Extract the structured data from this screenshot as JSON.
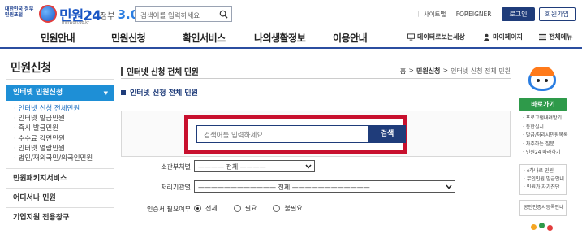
{
  "header": {
    "gov_logo_text": "대한민국 정부민원포털",
    "site_name": "민원24",
    "site_url": "minwon.go.kr",
    "gov30_prefix": "정부",
    "gov30_number": "3.0",
    "search_placeholder": "검색어를 입력하세요",
    "util_links": [
      "사이트맵",
      "FOREIGNER"
    ],
    "login_label": "로그인",
    "join_label": "회원가입"
  },
  "gnb": {
    "items": [
      "민원안내",
      "민원신청",
      "확인서비스",
      "나의생활정보",
      "이용안내"
    ],
    "right": [
      "데이터로보는세상",
      "마이페이지",
      "전체메뉴"
    ]
  },
  "lnb": {
    "title": "민원신청",
    "active": "인터넷 민원신청",
    "sub_items": [
      "인터넷 신청 전체민원",
      "인터넷 발급민원",
      "즉시 발급민원",
      "수수료 감면민원",
      "인터넷 열람민원",
      "법인/재외국민/외국인민원"
    ],
    "groups": [
      "민원패키지서비스",
      "어디서나 민원",
      "기업지원 전용창구"
    ]
  },
  "main": {
    "title": "인터넷 신청 전체 민원",
    "breadcrumb": {
      "home": "홈",
      "sep": ">",
      "mid": "민원신청",
      "current": "인터넷 신청 전체 민원"
    },
    "subtitle": "인터넷 신청 전체 민원",
    "search": {
      "placeholder": "검색어를 입력하세요",
      "button": "검색"
    },
    "filters": {
      "dept_label": "소관부처별",
      "dept_value": "———— 전체 ————",
      "agency_label": "처리기관별",
      "agency_value": "———————————— 전체 ————————————",
      "cert_label": "인증서 필요여부",
      "cert_options": [
        "전체",
        "필요",
        "불필요"
      ],
      "cert_selected": "전체"
    }
  },
  "quick": {
    "title": "바로가기",
    "links": [
      "프로그램내려받기",
      "통합실시",
      "발급/처리시민원목록",
      "자주하는 질문",
      "민원24 따라하기"
    ],
    "box_links": [
      "e하나로 민원",
      "무인민원 발급안내",
      "민원가 자가진단"
    ],
    "box2_link": "공인인증서등록안내"
  },
  "colors": {
    "brand_navy": "#1f3c7a",
    "lnb_active": "#1e8fd6",
    "highlight_red": "#c8102e",
    "quick_green": "#2e9a4a"
  }
}
